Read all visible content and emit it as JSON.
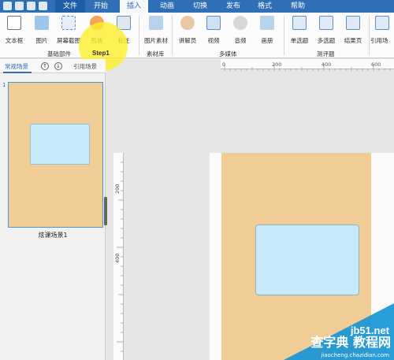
{
  "tabbar": {
    "tabs": [
      {
        "label": "文件",
        "state": "file"
      },
      {
        "label": "开始",
        "state": "normal"
      },
      {
        "label": "插入",
        "state": "active"
      },
      {
        "label": "动画",
        "state": "normal"
      },
      {
        "label": "切换",
        "state": "normal"
      },
      {
        "label": "发布",
        "state": "normal"
      },
      {
        "label": "格式",
        "state": "normal"
      },
      {
        "label": "帮助",
        "state": "normal"
      }
    ]
  },
  "ribbon": {
    "buttons": {
      "textbox": "文本框",
      "image": "图片",
      "screenshot": "屏幕截图",
      "shape": "形状",
      "annotation": "标注",
      "image_library": "图片素材",
      "narrator": "讲解员",
      "video": "视频",
      "audio": "音频",
      "album": "画册",
      "single_choice": "单选题",
      "multi_choice": "多选题",
      "result_page": "结果页",
      "reference_scene": "引用场"
    },
    "groups": {
      "basic": "基础部件",
      "library": "素材库",
      "multimedia": "多媒体",
      "quiz": "测评题"
    }
  },
  "annotation": {
    "step": "Step1"
  },
  "scene_panel": {
    "tab_normal": "常规场景",
    "tab_reference": "引用场景",
    "up_arrow": "↑",
    "down_arrow": "↓",
    "slide_number": "1",
    "scene_name": "炫课场景1"
  },
  "ruler": {
    "h_ticks": [
      "0",
      "200",
      "400",
      "600"
    ],
    "v_ticks": [
      "200",
      "400"
    ]
  },
  "watermark": {
    "site": "jb51.net",
    "text": "查字典 教程网",
    "url": "jiaocheng.chazidian.com"
  },
  "colors": {
    "accent": "#2f6fb5",
    "scene": "#f0cd97",
    "box": "#c5eafa",
    "highlight": "#fcf028"
  }
}
